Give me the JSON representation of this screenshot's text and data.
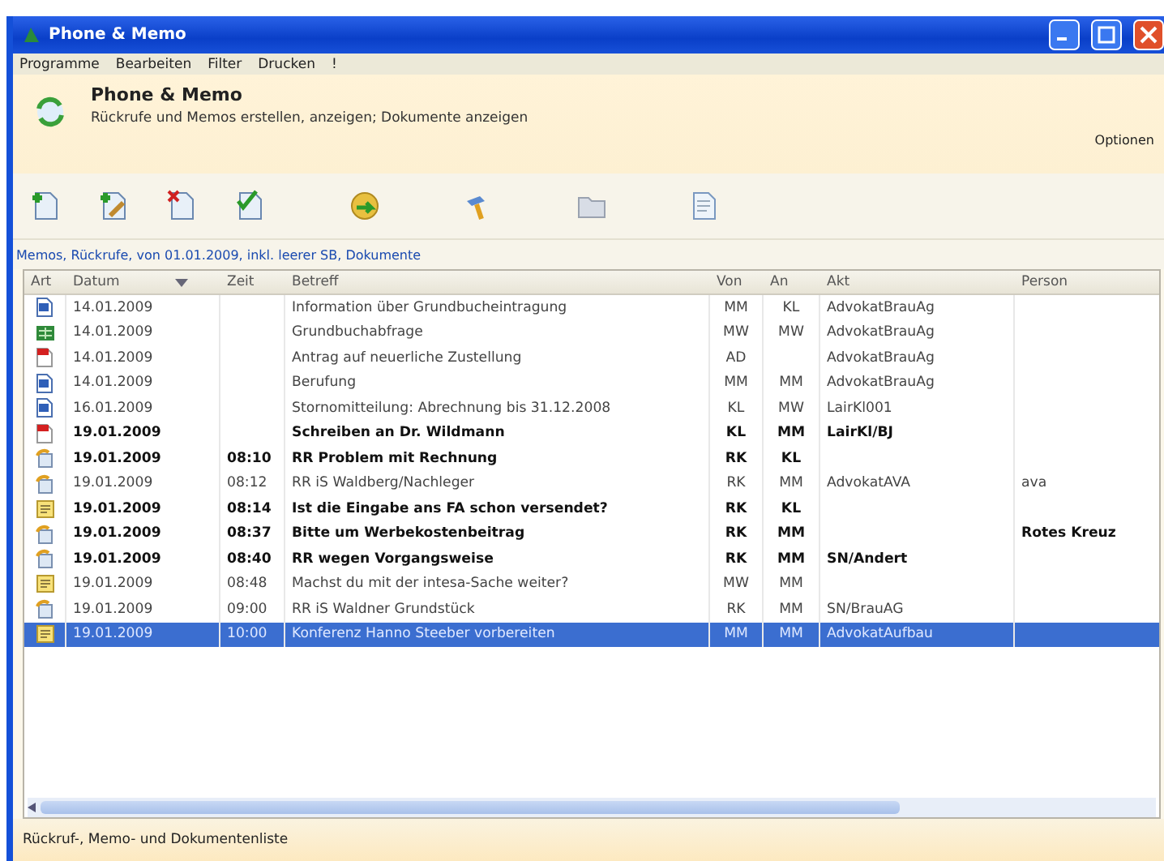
{
  "window": {
    "title": "Phone & Memo"
  },
  "menu": [
    "Programme",
    "Bearbeiten",
    "Filter",
    "Drucken",
    "!"
  ],
  "header": {
    "title": "Phone & Memo",
    "subtitle": "Rückrufe und Memos erstellen, anzeigen; Dokumente anzeigen",
    "options": "Optionen"
  },
  "filter_link": "Memos, Rückrufe, von 01.01.2009, inkl. leerer SB, Dokumente",
  "table": {
    "columns": [
      "Art",
      "Datum",
      "Zeit",
      "Betreff",
      "Von",
      "An",
      "Akt",
      "Person"
    ],
    "rows": [
      {
        "kind": "word",
        "date": "14.01.2009",
        "time": "",
        "subject": "Information über Grundbucheintragung",
        "from": "MM",
        "to": "KL",
        "file": "AdvokatBrauAg",
        "person": "",
        "unread": false,
        "selected": false
      },
      {
        "kind": "excel",
        "date": "14.01.2009",
        "time": "",
        "subject": "Grundbuchabfrage",
        "from": "MW",
        "to": "MW",
        "file": "AdvokatBrauAg",
        "person": "",
        "unread": false,
        "selected": false
      },
      {
        "kind": "pdf",
        "date": "14.01.2009",
        "time": "",
        "subject": "Antrag auf neuerliche Zustellung",
        "from": "AD",
        "to": "",
        "file": "AdvokatBrauAg",
        "person": "",
        "unread": false,
        "selected": false
      },
      {
        "kind": "word",
        "date": "14.01.2009",
        "time": "",
        "subject": "Berufung",
        "from": "MM",
        "to": "MM",
        "file": "AdvokatBrauAg",
        "person": "",
        "unread": false,
        "selected": false
      },
      {
        "kind": "word",
        "date": "16.01.2009",
        "time": "",
        "subject": "Stornomitteilung: Abrechnung bis 31.12.2008",
        "from": "KL",
        "to": "MW",
        "file": "LairKl001",
        "person": "",
        "unread": false,
        "selected": false
      },
      {
        "kind": "pdf",
        "date": "19.01.2009",
        "time": "",
        "subject": "Schreiben an Dr. Wildmann",
        "from": "KL",
        "to": "MM",
        "file": "LairKl/BJ",
        "person": "",
        "unread": true,
        "selected": false
      },
      {
        "kind": "phone",
        "date": "19.01.2009",
        "time": "08:10",
        "subject": "RR Problem mit Rechnung",
        "from": "RK",
        "to": "KL",
        "file": "",
        "person": "",
        "unread": true,
        "selected": false
      },
      {
        "kind": "phone",
        "date": "19.01.2009",
        "time": "08:12",
        "subject": "RR iS Waldberg/Nachleger",
        "from": "RK",
        "to": "MM",
        "file": "AdvokatAVA",
        "person": "ava",
        "unread": false,
        "selected": false
      },
      {
        "kind": "memo",
        "date": "19.01.2009",
        "time": "08:14",
        "subject": "Ist die Eingabe ans FA schon versendet?",
        "from": "RK",
        "to": "KL",
        "file": "",
        "person": "",
        "unread": true,
        "selected": false
      },
      {
        "kind": "phone",
        "date": "19.01.2009",
        "time": "08:37",
        "subject": "Bitte um Werbekostenbeitrag",
        "from": "RK",
        "to": "MM",
        "file": "",
        "person": "Rotes Kreuz",
        "unread": true,
        "selected": false
      },
      {
        "kind": "phone",
        "date": "19.01.2009",
        "time": "08:40",
        "subject": "RR wegen Vorgangsweise",
        "from": "RK",
        "to": "MM",
        "file": "SN/Andert",
        "person": "",
        "unread": true,
        "selected": false
      },
      {
        "kind": "memo",
        "date": "19.01.2009",
        "time": "08:48",
        "subject": "Machst du mit der intesa-Sache weiter?",
        "from": "MW",
        "to": "MM",
        "file": "",
        "person": "",
        "unread": false,
        "selected": false
      },
      {
        "kind": "phone",
        "date": "19.01.2009",
        "time": "09:00",
        "subject": "RR iS Waldner Grundstück",
        "from": "RK",
        "to": "MM",
        "file": "SN/BrauAG",
        "person": "",
        "unread": false,
        "selected": false
      },
      {
        "kind": "memo",
        "date": "19.01.2009",
        "time": "10:00",
        "subject": "Konferenz Hanno Steeber vorbereiten",
        "from": "MM",
        "to": "MM",
        "file": "AdvokatAufbau",
        "person": "",
        "unread": false,
        "selected": true
      }
    ]
  },
  "status_bar": "Rückruf-, Memo- und Dokumentenliste"
}
